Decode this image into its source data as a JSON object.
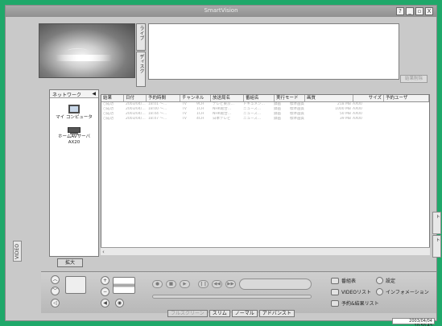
{
  "window": {
    "title": "SmartVision",
    "buttons": [
      "?",
      "_",
      "▫",
      "X"
    ]
  },
  "left_tab": {
    "label": "VIDEO"
  },
  "preview_tabs": [
    "ライブ",
    "ディスク"
  ],
  "info_panel": {
    "result_delete_label": "結果削除"
  },
  "network": {
    "header": "ネットワーク",
    "arrow": "◀",
    "devices": [
      {
        "label": "マイ コンピュータ"
      },
      {
        "label": "ホームAVサーバ\nAX20"
      }
    ]
  },
  "zoom_button": "拡大",
  "table": {
    "columns": [
      "結果",
      "日付",
      "予約時間",
      "チャンネル",
      "放送局名",
      "番組名",
      "実行モード",
      "画質",
      "サイズ",
      "予約ユーザ"
    ],
    "rows": [
      [
        "○成功",
        "2003/04/…",
        "18:01 ～…",
        "TV",
        "9CH",
        "テレビ東京…",
        "ドキュメン…",
        "録画",
        "標準画質",
        "218 MB",
        "AX00"
      ],
      [
        "○成功",
        "2003/04/…",
        "18:00 ～…",
        "TV",
        "1CH",
        "NHK総合…",
        "ニュース…",
        "録画",
        "標準画質",
        "1000 MB",
        "AX00"
      ],
      [
        "○成功",
        "2003/04/…",
        "18:44 ～…",
        "TV",
        "1CH",
        "NHK総合…",
        "ニュース…",
        "録画",
        "標準画質",
        "50 MB",
        "AX00"
      ],
      [
        "○成功",
        "2003/04/…",
        "18:47 ～…",
        "TV",
        "4CH",
        "日本テレビ",
        "ニュース…",
        "録画",
        "標準画質",
        "39 MB",
        "AX00"
      ]
    ]
  },
  "right_tabs": [
    "結果リスト",
    "予約リスト"
  ],
  "controls": {
    "menu": [
      {
        "label": "番組表",
        "icon": "tv-guide-icon"
      },
      {
        "label": "設定",
        "icon": "settings-icon"
      },
      {
        "label": "VIDEOリスト",
        "icon": "video-list-icon"
      },
      {
        "label": "インフォメーション",
        "icon": "information-icon"
      },
      {
        "label": "予約&結果リスト",
        "icon": "reservation-list-icon"
      }
    ],
    "modes": [
      {
        "label": "フルスクリーン",
        "dim": true
      },
      {
        "label": "スリム",
        "dim": false
      },
      {
        "label": "ノーマル",
        "dim": false
      },
      {
        "label": "アドバンスト",
        "dim": false
      }
    ]
  },
  "status": {
    "datetime": "2003/04/04 10:50:43"
  }
}
